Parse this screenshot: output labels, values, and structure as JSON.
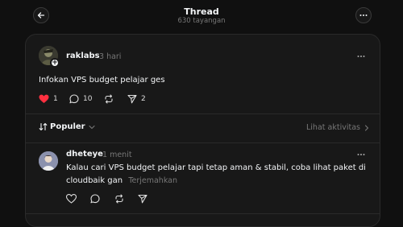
{
  "header": {
    "title": "Thread",
    "views": "630 tayangan"
  },
  "post": {
    "username": "raklabs",
    "time": "3 hari",
    "text": "Infokan VPS budget pelajar ges",
    "likes": "1",
    "replies": "10",
    "shares": "2"
  },
  "sort": {
    "label": "Populer",
    "activity_link": "Lihat aktivitas"
  },
  "reply": {
    "username": "dheteye",
    "time": "1 menit",
    "text_line1": "Kalau cari VPS budget pelajar tapi tetap aman & stabil, coba lihat paket di",
    "text_line2": "cloudbaik gan",
    "translate": "Terjemahkan"
  },
  "colors": {
    "like_red": "#ff3040",
    "background": "#101010",
    "card": "#181818"
  }
}
